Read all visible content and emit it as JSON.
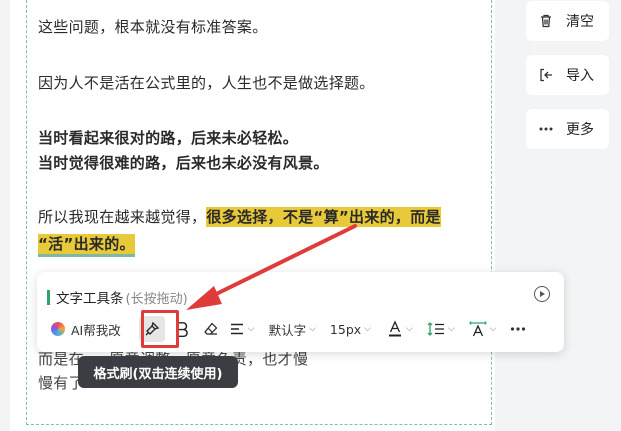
{
  "doc": {
    "lines": [
      "这些问题，根本就没有标准答案。",
      "因为人不是活在公式里的，人生也不是做选择题。",
      "当时看起来很对的路，后来未必轻松。",
      "当时觉得很难的路，后来也未必没有风景。",
      "所以我现在越来越觉得，",
      "很多选择，不是“算”出来的，而是",
      "“活”出来的。",
      "而是在 … 愿意调整，愿意负责，也才慢",
      "慢有了"
    ]
  },
  "side": {
    "clear": "清空",
    "import": "导入",
    "more": "更多"
  },
  "toolbar": {
    "title": "文字工具条",
    "hint": "(长按拖动)",
    "ai": "AI帮我改",
    "font": "默认字",
    "size": "15px"
  },
  "tooltip": "格式刷(双击连续使用)",
  "colors": {
    "highlight": "#e8c93a",
    "accent": "#2fa36b",
    "annotation": "#e03b3b"
  }
}
